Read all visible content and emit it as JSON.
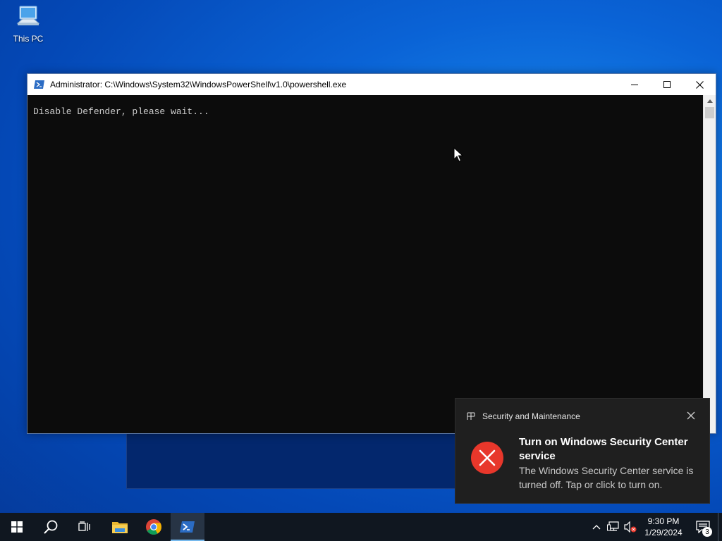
{
  "desktop": {
    "icons": [
      {
        "label": "This PC",
        "icon": "this-pc-icon"
      }
    ],
    "background_color": "#0a63d6"
  },
  "console_window": {
    "title": "Administrator: C:\\Windows\\System32\\WindowsPowerShell\\v1.0\\powershell.exe",
    "output": "Disable Defender, please wait...",
    "buttons": [
      "minimize",
      "maximize",
      "close"
    ]
  },
  "notification": {
    "source": "Security and Maintenance",
    "title": "Turn on Windows Security Center service",
    "body": "The Windows Security Center service is turned off. Tap or click to turn on.",
    "icon": "error-icon",
    "accent": "#e8372b"
  },
  "taskbar": {
    "items": [
      "start-icon",
      "search-icon",
      "task-view-icon",
      "file-explorer-icon",
      "chrome-icon",
      "powershell-icon"
    ],
    "time": "9:30 PM",
    "date": "1/29/2024",
    "notification_count": "3"
  }
}
